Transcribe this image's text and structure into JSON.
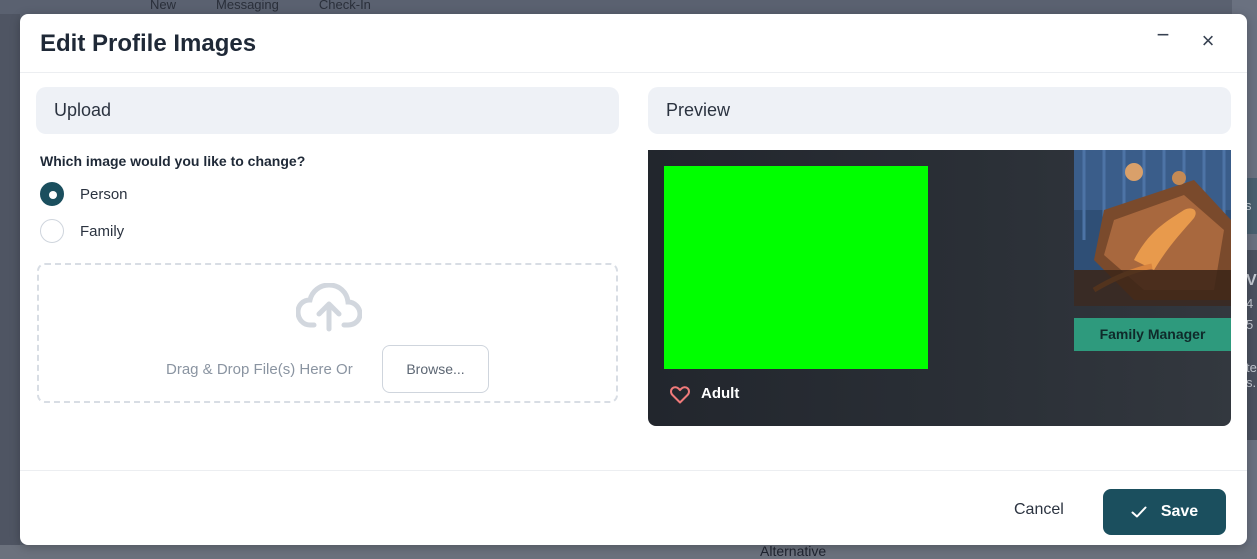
{
  "background": {
    "nav_items": [
      "New",
      "Messaging",
      "Check-In"
    ],
    "right_chip": "s",
    "right_card_lines": [
      "V",
      "4",
      "5",
      "te",
      "s."
    ],
    "bottom_text": "Alternative"
  },
  "modal": {
    "title": "Edit Profile Images",
    "minimize_label": "−",
    "close_label": "×"
  },
  "upload": {
    "heading": "Upload",
    "question": "Which image would you like to change?",
    "options": [
      {
        "label": "Person",
        "checked": true
      },
      {
        "label": "Family",
        "checked": false
      }
    ],
    "drop_text": "Drag & Drop File(s) Here Or",
    "browse_label": "Browse...",
    "upload_icon": "cloud-upload-icon"
  },
  "preview": {
    "heading": "Preview",
    "person_image_color": "#00ff00",
    "person_type": "Adult",
    "family_badge": "Family Manager",
    "heart_icon": "heart-outline-icon"
  },
  "footer": {
    "cancel_label": "Cancel",
    "save_label": "Save",
    "save_icon": "check-icon"
  },
  "colors": {
    "primary": "#1b4f5e",
    "badge_green": "#2e9a7d",
    "heart_red": "#f07a7a"
  }
}
